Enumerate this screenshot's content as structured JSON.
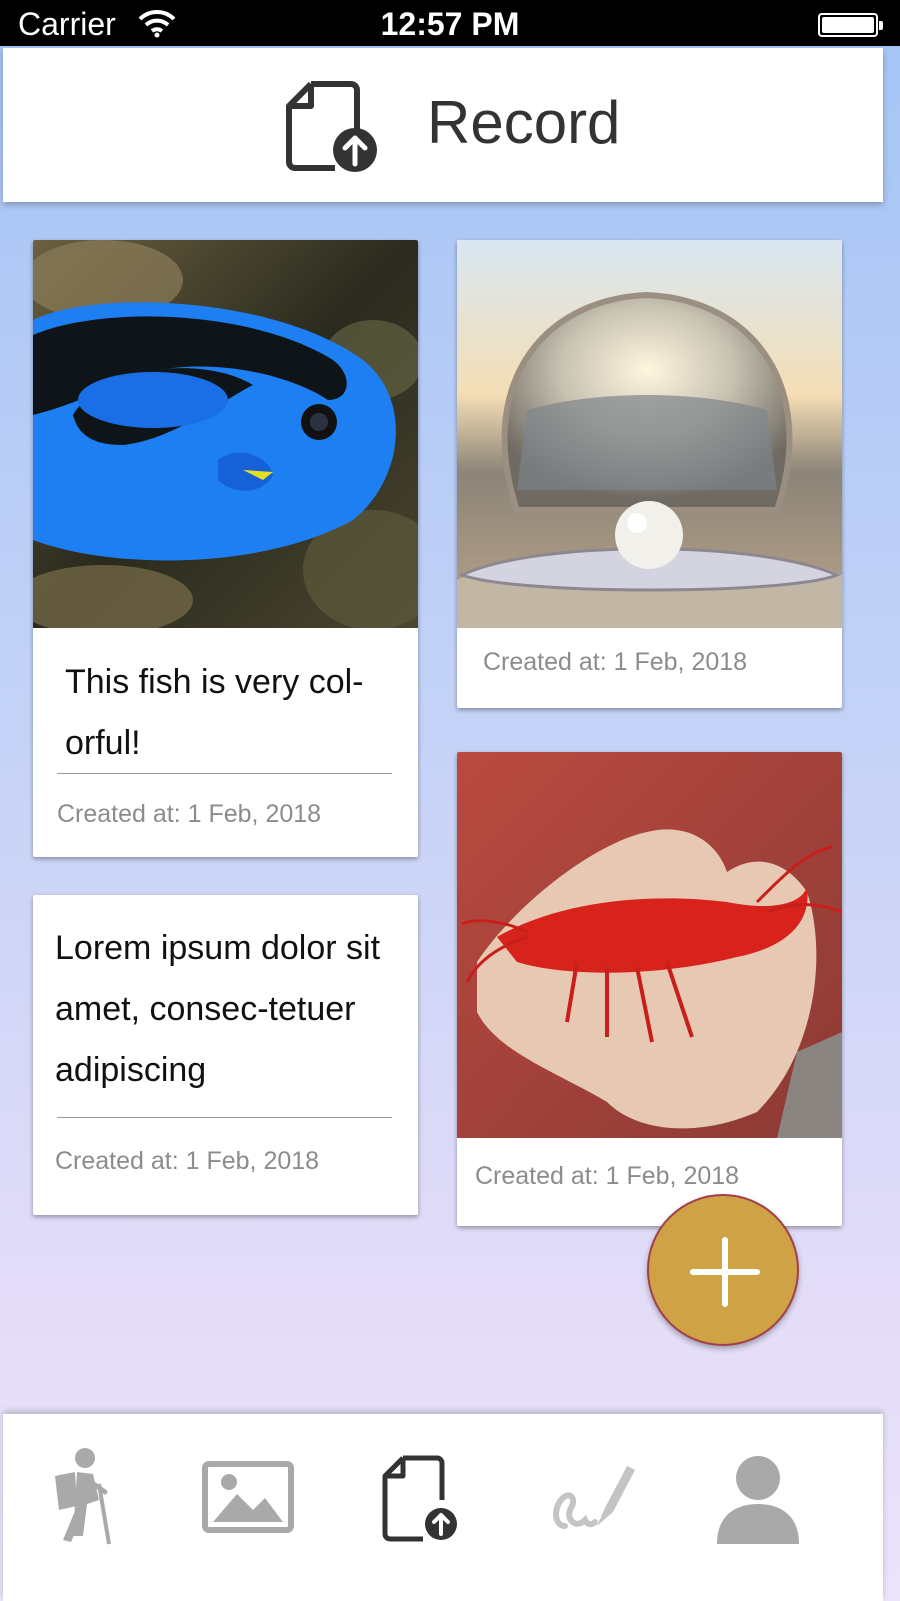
{
  "status_bar": {
    "carrier": "Carrier",
    "time": "12:57 PM"
  },
  "header": {
    "title": "Record",
    "icon": "file-upload-icon"
  },
  "cards": [
    {
      "image": "blue-tang-fish-photo",
      "caption": "This fish is very col-orful!",
      "created": "Created at: 1 Feb, 2018"
    },
    {
      "image": "pearl-seashell-photo",
      "created": "Created at: 1 Feb, 2018"
    },
    {
      "caption": "Lorem ipsum dolor sit amet, consec-tetuer adipiscing",
      "created": "Created at: 1 Feb, 2018"
    },
    {
      "image": "red-shrimp-in-hand-photo",
      "created": "Created at: 1 Feb, 2018"
    }
  ],
  "fab": {
    "icon": "plus-icon"
  },
  "tab_bar": {
    "items": [
      {
        "icon": "hiker-icon",
        "active": false
      },
      {
        "icon": "image-icon",
        "active": false
      },
      {
        "icon": "file-upload-icon",
        "active": true
      },
      {
        "icon": "signature-pen-icon",
        "active": false
      },
      {
        "icon": "user-icon",
        "active": false
      }
    ]
  },
  "colors": {
    "accent_fab": "#cfa345",
    "fab_border": "#a2404a",
    "tab_inactive": "#a9a9a9",
    "tab_active": "#333333",
    "bg_top": "#a4c4f5",
    "bg_bottom": "#ece4fa"
  }
}
